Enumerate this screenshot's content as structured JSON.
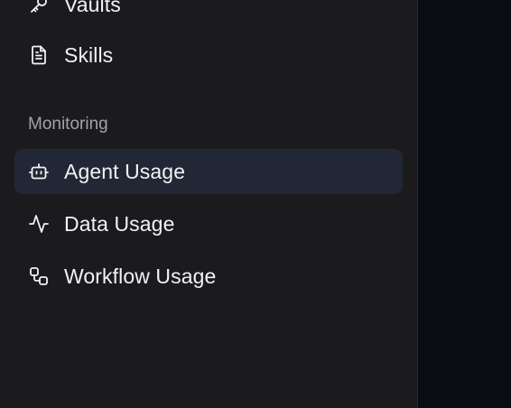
{
  "sidebar": {
    "items_top": [
      {
        "label": "Vaults",
        "icon": "key-icon"
      },
      {
        "label": "Skills",
        "icon": "file-text-icon"
      }
    ],
    "monitoring": {
      "header": "Monitoring",
      "items": [
        {
          "label": "Agent Usage",
          "icon": "bot-icon",
          "active": true
        },
        {
          "label": "Data Usage",
          "icon": "activity-icon",
          "active": false
        },
        {
          "label": "Workflow Usage",
          "icon": "workflow-icon",
          "active": false
        }
      ]
    }
  },
  "colors": {
    "sidebar_bg": "#1b1b1d",
    "main_bg": "#0a0c13",
    "active_item_bg": "#212735",
    "text": "#f2f2f4",
    "section_header": "#a2a3a8"
  }
}
